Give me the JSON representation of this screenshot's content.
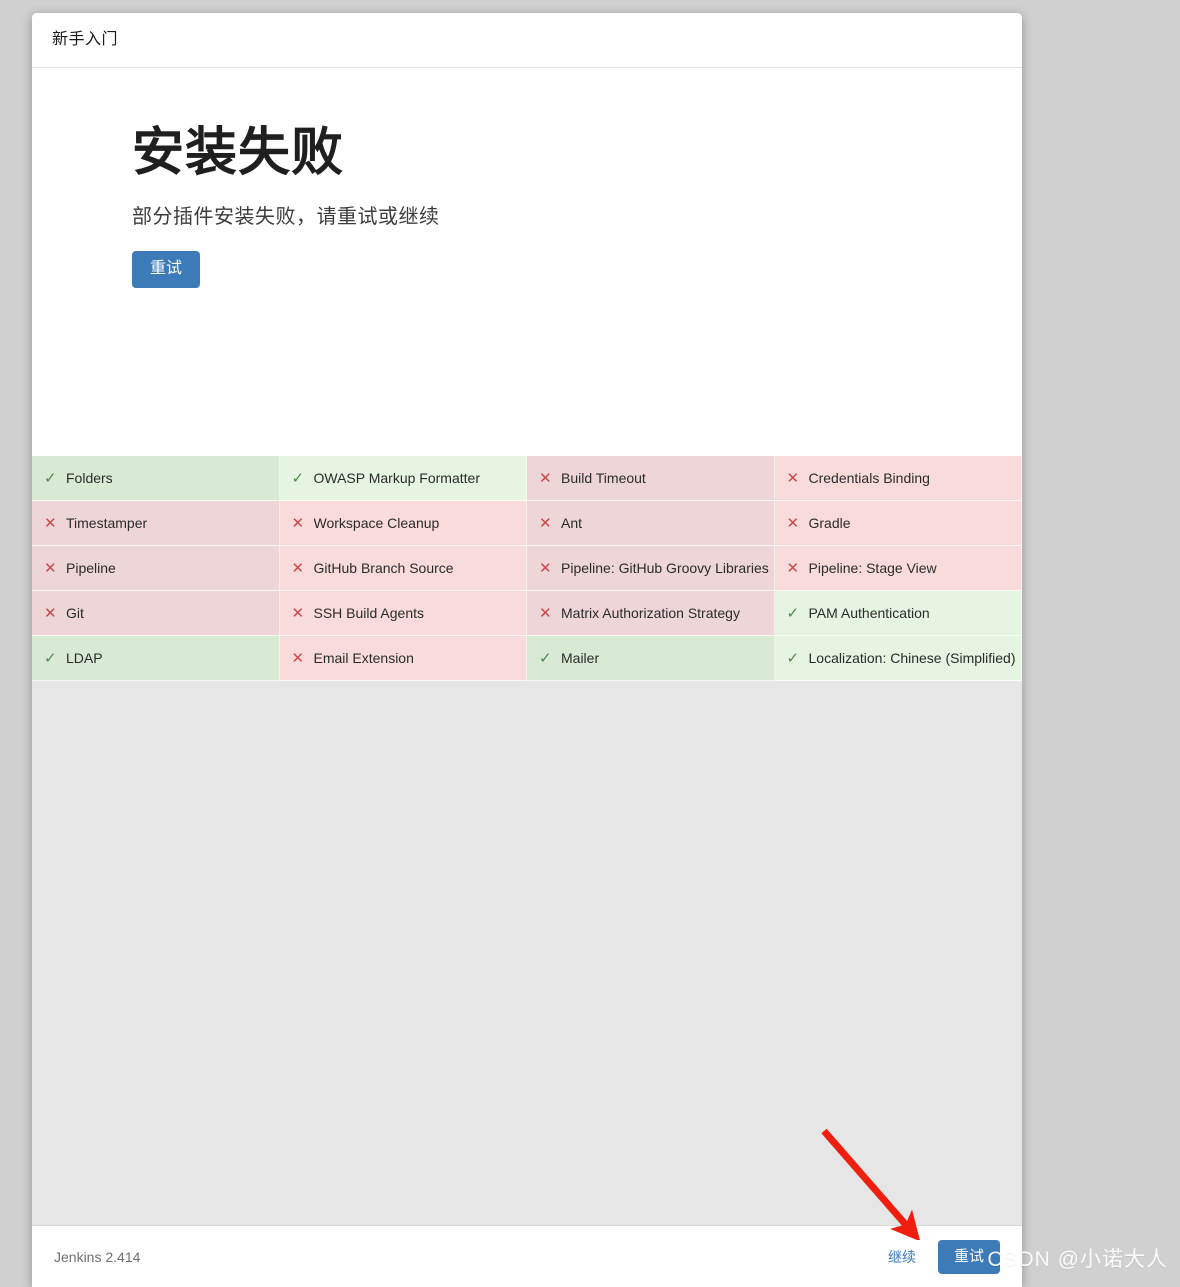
{
  "window": {
    "header_title": "新手入门"
  },
  "hero": {
    "heading": "安装失败",
    "subtitle": "部分插件安装失败，请重试或继续",
    "retry_label": "重试"
  },
  "icons": {
    "check": "✓",
    "cross": "✕"
  },
  "plugins": {
    "columns": 4,
    "items": [
      {
        "name": "Folders",
        "status": "ok"
      },
      {
        "name": "OWASP Markup Formatter",
        "status": "ok"
      },
      {
        "name": "Build Timeout",
        "status": "fail"
      },
      {
        "name": "Credentials Binding",
        "status": "fail"
      },
      {
        "name": "Timestamper",
        "status": "fail"
      },
      {
        "name": "Workspace Cleanup",
        "status": "fail"
      },
      {
        "name": "Ant",
        "status": "fail"
      },
      {
        "name": "Gradle",
        "status": "fail"
      },
      {
        "name": "Pipeline",
        "status": "fail"
      },
      {
        "name": "GitHub Branch Source",
        "status": "fail"
      },
      {
        "name": "Pipeline: GitHub Groovy Libraries",
        "status": "fail"
      },
      {
        "name": "Pipeline: Stage View",
        "status": "fail"
      },
      {
        "name": "Git",
        "status": "fail"
      },
      {
        "name": "SSH Build Agents",
        "status": "fail"
      },
      {
        "name": "Matrix Authorization Strategy",
        "status": "fail"
      },
      {
        "name": "PAM Authentication",
        "status": "ok"
      },
      {
        "name": "LDAP",
        "status": "ok"
      },
      {
        "name": "Email Extension",
        "status": "fail"
      },
      {
        "name": "Mailer",
        "status": "ok"
      },
      {
        "name": "Localization: Chinese (Simplified)",
        "status": "ok"
      }
    ]
  },
  "footer": {
    "version": "Jenkins 2.414",
    "continue_label": "继续",
    "retry_label": "重试"
  },
  "watermark": {
    "text": "CSDN @小诺大人"
  },
  "colors": {
    "accent_blue": "#3d7ab8",
    "success_bg": "#d9ead4",
    "success_bg_alt": "#e6f4e2",
    "failure_bg": "#eed6d8",
    "failure_bg_alt": "#fadbdb",
    "success_mark": "#4e8a4b",
    "failure_mark": "#c94a4a",
    "page_bg": "#d0d0d0",
    "annotation_arrow": "#f01e0f"
  }
}
